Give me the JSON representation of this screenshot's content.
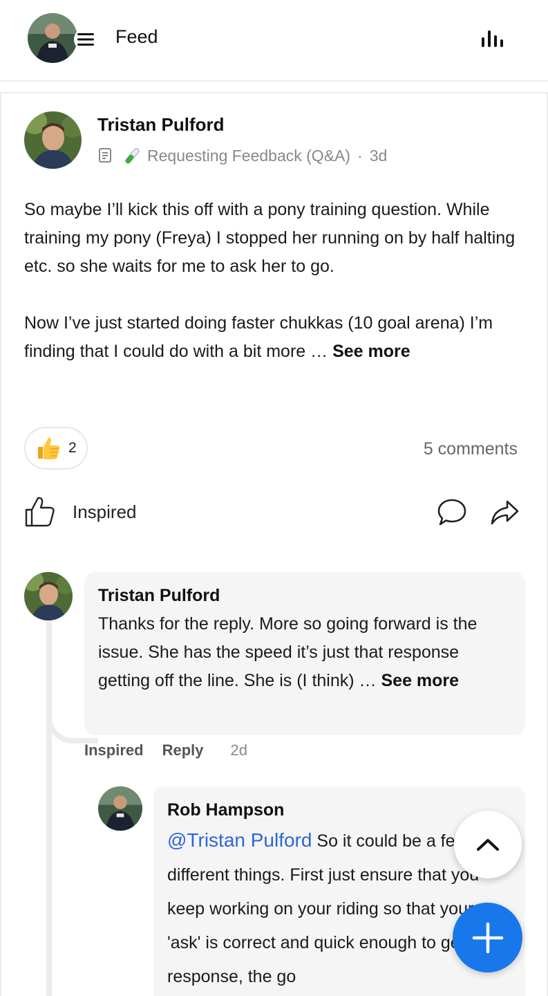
{
  "header": {
    "title": "Feed",
    "menu_icon": "hamburger-menu-icon",
    "stats_icon": "bar-chart-icon"
  },
  "post": {
    "author": "Tristan Pulford",
    "category": "Requesting Feedback (Q&A)",
    "category_icon": "test-tube-icon",
    "post_type_icon": "document-icon",
    "separator": "·",
    "time": "3d",
    "body_paragraph_1": "So maybe I’ll kick this off with a pony training question. While training my pony (Freya) I stopped her running on by half halting etc. so she waits for me to ask her to go.",
    "body_paragraph_2": "Now I’ve just started doing faster chukkas (10 goal arena) I’m finding that I could do with a bit more … ",
    "see_more": "See more",
    "reaction_count": "2",
    "comments_count": "5 comments",
    "like_label": "Inspired"
  },
  "comments": [
    {
      "author": "Tristan Pulford",
      "text": "Thanks for the reply. More so going forward is the issue. She has the speed it’s just that response getting off the line. She is (I think) … ",
      "see_more": "See more",
      "action_like": "Inspired",
      "action_reply": "Reply",
      "time": "2d"
    },
    {
      "author": "Rob Hampson",
      "mention": "@Tristan Pulford",
      "text": " So it could be a few different things. First just ensure that you keep working on your riding so that your 'ask' is correct and quick enough to get the response, the go"
    }
  ],
  "colors": {
    "accent_blue": "#1877ea",
    "mention_blue": "#2b66d9",
    "bubble_bg": "#f5f5f6",
    "muted_text": "#888888"
  }
}
